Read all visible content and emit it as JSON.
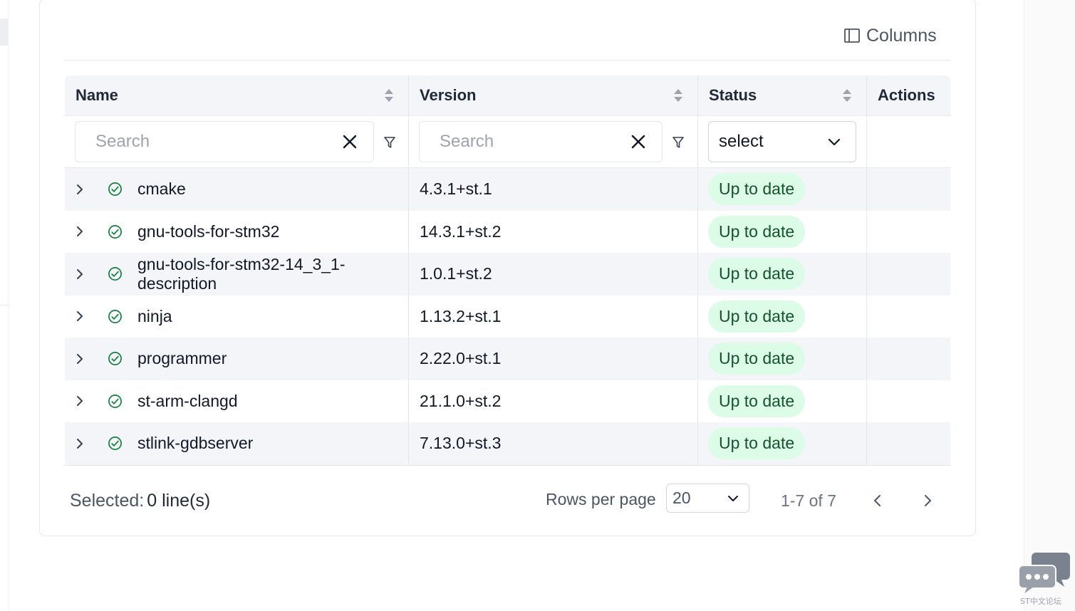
{
  "toolbar": {
    "columns_label": "Columns"
  },
  "table": {
    "headers": {
      "name": "Name",
      "version": "Version",
      "status": "Status",
      "actions": "Actions"
    },
    "filters": {
      "name_placeholder": "Search",
      "version_placeholder": "Search",
      "status_select_value": "select"
    },
    "rows": [
      {
        "name": "cmake",
        "version": "4.3.1+st.1",
        "status": "Up to date"
      },
      {
        "name": "gnu-tools-for-stm32",
        "version": "14.3.1+st.2",
        "status": "Up to date"
      },
      {
        "name": "gnu-tools-for-stm32-14_3_1-description",
        "version": "1.0.1+st.2",
        "status": "Up to date"
      },
      {
        "name": "ninja",
        "version": "1.13.2+st.1",
        "status": "Up to date"
      },
      {
        "name": "programmer",
        "version": "2.22.0+st.1",
        "status": "Up to date"
      },
      {
        "name": "st-arm-clangd",
        "version": "21.1.0+st.2",
        "status": "Up to date"
      },
      {
        "name": "stlink-gdbserver",
        "version": "7.13.0+st.3",
        "status": "Up to date"
      }
    ]
  },
  "footer": {
    "selected_label": "Selected:",
    "selected_value": "0 line(s)",
    "rows_per_page_label": "Rows per page",
    "rows_per_page_value": "20",
    "range_text": "1-7 of 7"
  },
  "widget": {
    "caption": "ST中文论坛"
  },
  "colors": {
    "badge_bg": "#dcfce7",
    "badge_text": "#14532d",
    "status_ok": "#15803d",
    "header_bg": "#f3f5f9"
  }
}
